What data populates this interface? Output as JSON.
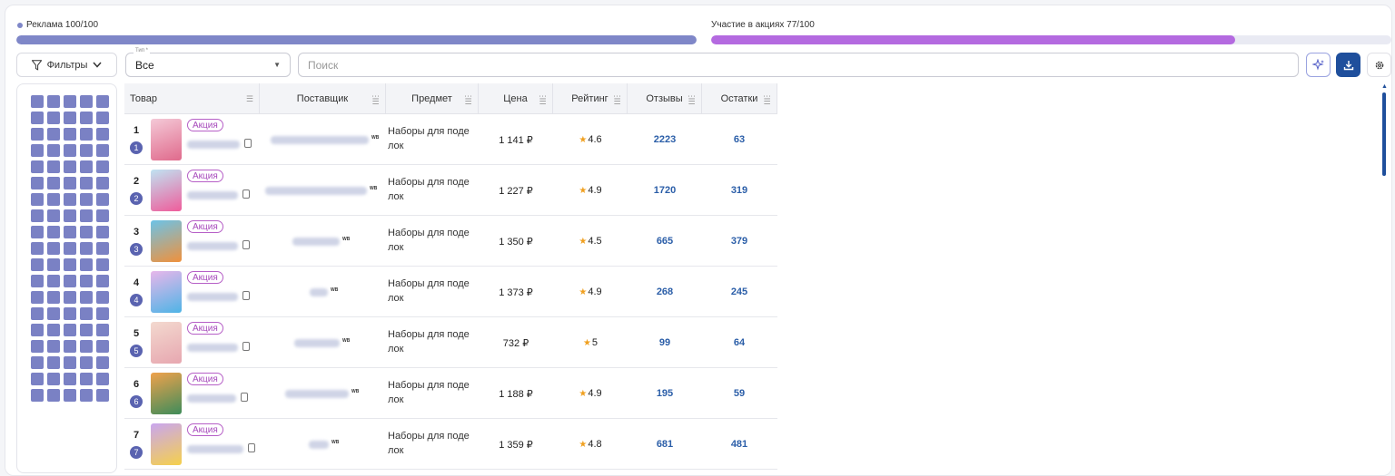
{
  "progress": {
    "ads": {
      "label": "Реклама 100/100",
      "percent": 100,
      "color": "#7f87c8"
    },
    "promotions": {
      "label": "Участие в акциях 77/100",
      "percent": 77,
      "color": "#b46ae0"
    }
  },
  "toolbar": {
    "filters_label": "Фильтры",
    "type_legend": "Тип *",
    "type_value": "Все",
    "search_placeholder": "Поиск"
  },
  "table": {
    "columns": [
      "Товар",
      "Поставщик",
      "Предмет",
      "Цена",
      "Рейтинг",
      "Отзывы",
      "Остатки"
    ],
    "rows": [
      {
        "rank": "1",
        "position": "1",
        "promo": "Акция",
        "wb": "WB",
        "subject": "Наборы для поде лок",
        "price": "1 141 ₽",
        "rating": "4.6",
        "reviews": "2223",
        "stock": "63"
      },
      {
        "rank": "2",
        "position": "2",
        "promo": "Акция",
        "wb": "WB",
        "subject": "Наборы для поде лок",
        "price": "1 227 ₽",
        "rating": "4.9",
        "reviews": "1720",
        "stock": "319"
      },
      {
        "rank": "3",
        "position": "3",
        "promo": "Акция",
        "wb": "WB",
        "subject": "Наборы для поде лок",
        "price": "1 350 ₽",
        "rating": "4.5",
        "reviews": "665",
        "stock": "379"
      },
      {
        "rank": "4",
        "position": "4",
        "promo": "Акция",
        "wb": "WB",
        "subject": "Наборы для поде лок",
        "price": "1 373 ₽",
        "rating": "4.9",
        "reviews": "268",
        "stock": "245"
      },
      {
        "rank": "5",
        "position": "5",
        "promo": "Акция",
        "wb": "WB",
        "subject": "Наборы для поде лок",
        "price": "732 ₽",
        "rating": "5",
        "reviews": "99",
        "stock": "64"
      },
      {
        "rank": "6",
        "position": "6",
        "promo": "Акция",
        "wb": "WB",
        "subject": "Наборы для поде лок",
        "price": "1 188 ₽",
        "rating": "4.9",
        "reviews": "195",
        "stock": "59"
      },
      {
        "rank": "7",
        "position": "7",
        "promo": "Акция",
        "wb": "WB",
        "subject": "Наборы для поде лок",
        "price": "1 359 ₽",
        "rating": "4.8",
        "reviews": "681",
        "stock": "481"
      }
    ]
  },
  "icons": {
    "filter": "funnel-icon",
    "ai": "sparkle-icon",
    "download": "download-icon",
    "settings": "gear-icon"
  },
  "colors": {
    "accent": "#1f4f9c",
    "badge": "#5a63b0",
    "promo": "#a648bb",
    "star": "#f0a020"
  }
}
